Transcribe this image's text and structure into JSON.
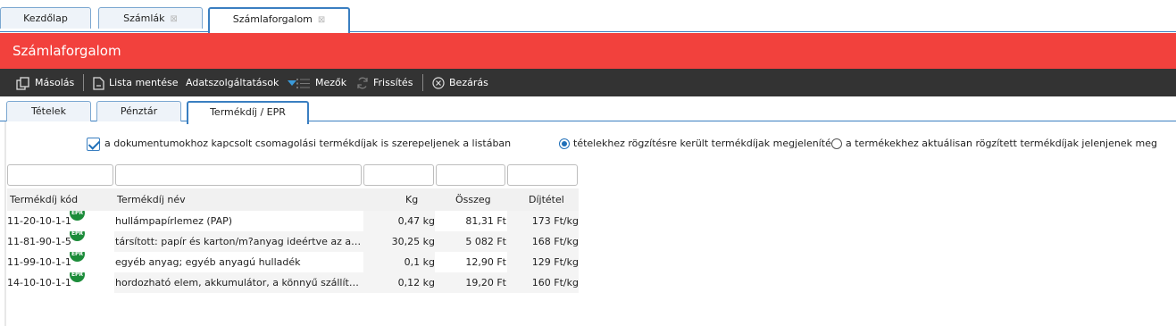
{
  "top_tabs": [
    {
      "label": "Kezdőlap",
      "closable": false,
      "active": false
    },
    {
      "label": "Számlák",
      "closable": true,
      "active": false
    },
    {
      "label": "Számlaforgalom",
      "closable": true,
      "active": true
    }
  ],
  "page_title": "Számlaforgalom",
  "toolbar": {
    "copy": "Másolás",
    "save_list": "Lista mentése",
    "services": "Adatszolgáltatások",
    "fields": "Mezők",
    "refresh": "Frissítés",
    "close": "Bezárás"
  },
  "sub_tabs": [
    {
      "label": "Tételek",
      "active": false
    },
    {
      "label": "Pénztár",
      "active": false
    },
    {
      "label": "Termékdíj / EPR",
      "active": true
    }
  ],
  "options": {
    "include_packaging_label": "a dokumentumokhoz kapcsolt csomagolási termékdíjak is szerepeljenek a listában",
    "include_packaging_checked": true,
    "radio_recorded_label": "tételekhez rögzítésre került termékdíjak megjelenítése",
    "radio_current_label": "a termékekhez aktuálisan rögzített termékdíjak jelenjenek meg",
    "selected": "recorded"
  },
  "table": {
    "headers": {
      "code": "Termékdíj kód",
      "name": "Termékdíj név",
      "kg": "Kg",
      "amount": "Összeg",
      "rate": "Díjtétel"
    },
    "badge": "EPR",
    "rows": [
      {
        "code": "11-20-10-1-1",
        "name": "hullámpapírlemez (PAP)",
        "kg": "0,47 kg",
        "amount": "81,31 Ft",
        "rate": "173 Ft/kg"
      },
      {
        "code": "11-81-90-1-5",
        "name": "társított: papír és karton/m?anyag ideértve az abból…",
        "kg": "30,25 kg",
        "amount": "5 082 Ft",
        "rate": "168 Ft/kg"
      },
      {
        "code": "11-99-10-1-1",
        "name": "egyéb anyag; egyéb anyagú hulladék",
        "kg": "0,1 kg",
        "amount": "12,90 Ft",
        "rate": "129 Ft/kg"
      },
      {
        "code": "14-10-10-1-1",
        "name": "hordozható elem, akkumulátor, a könnyű szállítóes…",
        "kg": "0,12 kg",
        "amount": "19,20 Ft",
        "rate": "160 Ft/kg"
      }
    ]
  }
}
